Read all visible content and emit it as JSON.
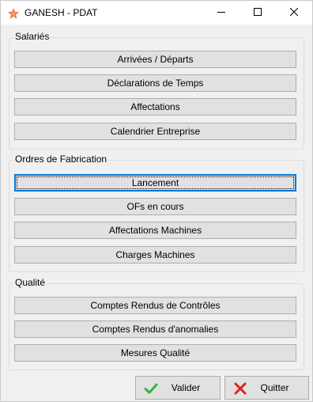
{
  "window": {
    "title": "GANESH - PDAT",
    "icon": "star-logo-icon",
    "accent": "#0078d7"
  },
  "groups": [
    {
      "label": "Salariés",
      "buttons": [
        "Arrivées / Départs",
        "Déclarations de Temps",
        "Affectations",
        "Calendrier Entreprise"
      ]
    },
    {
      "label": "Ordres de Fabrication",
      "buttons": [
        "Lancement",
        "OFs en cours",
        "Affectations Machines",
        "Charges Machines"
      ],
      "focused_button": "Lancement"
    },
    {
      "label": "Qualité",
      "buttons": [
        "Comptes Rendus de Contrôles",
        "Comptes Rendus d'anomalies",
        "Mesures Qualité"
      ]
    }
  ],
  "footer": {
    "validate_label": "Valider",
    "validate_icon": "green-check-icon",
    "quit_label": "Quitter",
    "quit_icon": "red-x-icon"
  }
}
